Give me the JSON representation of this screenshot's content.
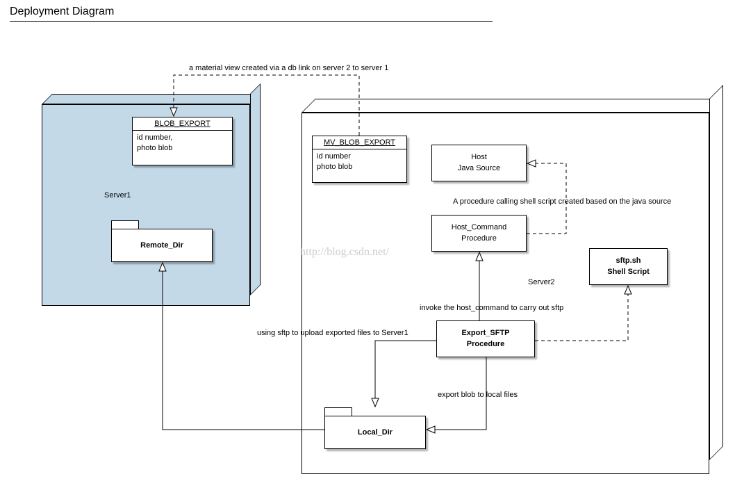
{
  "title": "Deployment Diagram",
  "watermark": "http://blog.csdn.net/",
  "server1": {
    "name": "Server1"
  },
  "server2": {
    "name": "Server2"
  },
  "blob_export": {
    "name": "BLOB_EXPORT",
    "attrs": "id number,\nphoto blob"
  },
  "mv_blob_export": {
    "name": "MV_BLOB_EXPORT",
    "attrs": "id number\nphoto blob"
  },
  "remote_dir": {
    "name": "Remote_Dir"
  },
  "local_dir": {
    "name": "Local_Dir"
  },
  "host_java": {
    "text": "Host\nJava Source"
  },
  "host_cmd": {
    "text": "Host_Command\nProcedure"
  },
  "sftp_sh": {
    "text": "sftp.sh\nShell Script"
  },
  "export_sftp": {
    "text": "Export_SFTP\nProcedure"
  },
  "labels": {
    "mv_link": "a material view created via a db link on server 2 to server 1",
    "proc_java": "A procedure calling shell script created based on the java source",
    "invoke_host": "invoke the host_command to carry out sftp",
    "sftp_upload": "using sftp to upload exported files to Server1",
    "export_blob": "export blob to local files"
  }
}
